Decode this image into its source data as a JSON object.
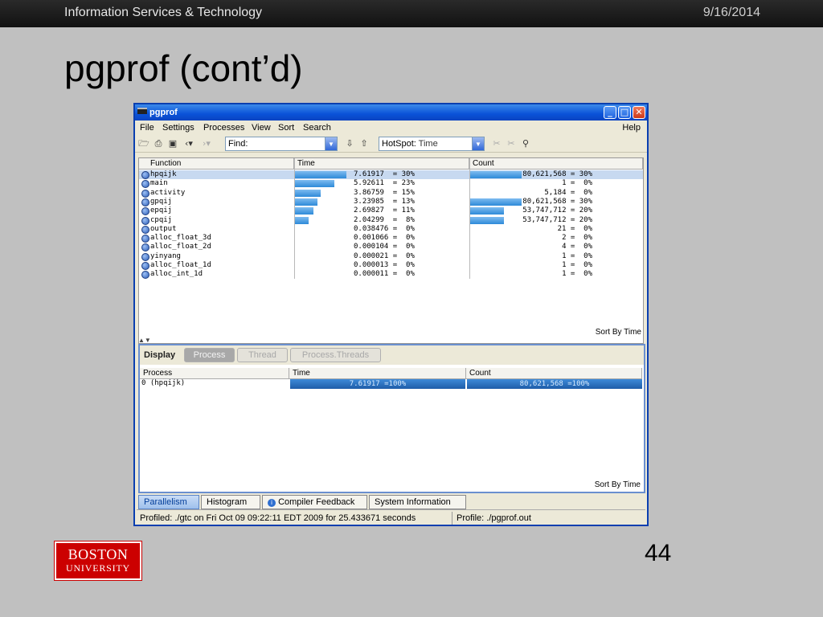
{
  "slide": {
    "org": "Information Services & Technology",
    "date": "9/16/2014",
    "title": "pgprof (cont’d)",
    "page_number": "44",
    "logo_line1": "BOSTON",
    "logo_line2": "UNIVERSITY"
  },
  "window": {
    "title": "pgprof",
    "menus": [
      "File",
      "Settings",
      "Processes",
      "View",
      "Sort",
      "Search"
    ],
    "help": "Help",
    "find_label": "Find:",
    "hotspot_label": "HotSpot:",
    "hotspot_value": "Time"
  },
  "upper_table": {
    "headers": [
      "Function",
      "Time",
      "Count"
    ],
    "rows": [
      {
        "name": "hpqijk",
        "time": "7.61917  = 30%",
        "time_pct": 30,
        "count": "80,621,568 = 30%",
        "count_pct": 30
      },
      {
        "name": "main",
        "time": "5.92611  = 23%",
        "time_pct": 23,
        "count": "1 =  0%",
        "count_pct": 0
      },
      {
        "name": "activity",
        "time": "3.86759  = 15%",
        "time_pct": 15,
        "count": "5,184 =  0%",
        "count_pct": 0
      },
      {
        "name": "gpqij",
        "time": "3.23985  = 13%",
        "time_pct": 13,
        "count": "80,621,568 = 30%",
        "count_pct": 30
      },
      {
        "name": "epqij",
        "time": "2.69827  = 11%",
        "time_pct": 11,
        "count": "53,747,712 = 20%",
        "count_pct": 20
      },
      {
        "name": "cpqij",
        "time": "2.04299  =  8%",
        "time_pct": 8,
        "count": "53,747,712 = 20%",
        "count_pct": 20
      },
      {
        "name": "output",
        "time": "0.038476 =  0%",
        "time_pct": 0,
        "count": "21 =  0%",
        "count_pct": 0
      },
      {
        "name": "alloc_float_3d",
        "time": "0.001066 =  0%",
        "time_pct": 0,
        "count": "2 =  0%",
        "count_pct": 0
      },
      {
        "name": "alloc_float_2d",
        "time": "0.000104 =  0%",
        "time_pct": 0,
        "count": "4 =  0%",
        "count_pct": 0
      },
      {
        "name": "yinyang",
        "time": "0.000021 =  0%",
        "time_pct": 0,
        "count": "1 =  0%",
        "count_pct": 0
      },
      {
        "name": "alloc_float_1d",
        "time": "0.000013 =  0%",
        "time_pct": 0,
        "count": "1 =  0%",
        "count_pct": 0
      },
      {
        "name": "alloc_int_1d",
        "time": "0.000011 =  0%",
        "time_pct": 0,
        "count": "1 =  0%",
        "count_pct": 0
      }
    ],
    "sort_label": "Sort By Time"
  },
  "lower_pane": {
    "display_label": "Display",
    "buttons": [
      "Process",
      "Thread",
      "Process.Threads"
    ],
    "headers": [
      "Process",
      "Time",
      "Count"
    ],
    "row": {
      "process": "0 (hpqijk)",
      "time": "7.61917  =100%",
      "count": "80,621,568 =100%"
    },
    "sort_label": "Sort By Time"
  },
  "tabs": [
    "Parallelism",
    "Histogram",
    "Compiler Feedback",
    "System Information"
  ],
  "status": {
    "left": "Profiled: ./gtc on Fri Oct 09 09:22:11 EDT 2009 for 25.433671 seconds",
    "right": "Profile: ./pgprof.out"
  }
}
